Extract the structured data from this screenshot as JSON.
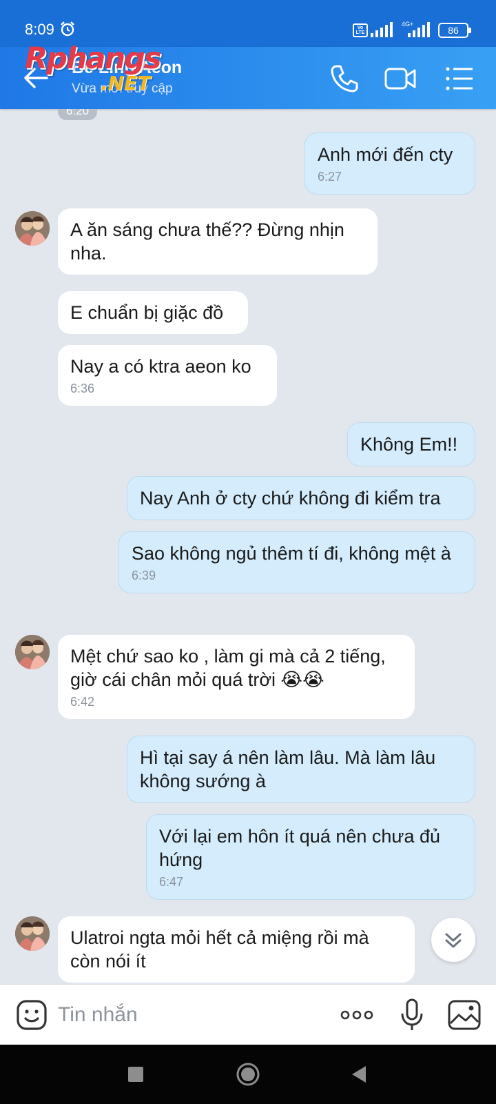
{
  "status_bar": {
    "time": "8:09",
    "volte": "Vo LTE",
    "network": "4G+",
    "battery": "86"
  },
  "header": {
    "contact_name": "Bé Linh Aeon",
    "contact_status": "Vừa mới truy cập",
    "watermark_main": "Rphangs",
    "watermark_suffix": ".NET",
    "icons": [
      "back-arrow-icon",
      "phone-icon",
      "video-call-icon",
      "menu-list-icon"
    ]
  },
  "chat": {
    "top_time_chip": "6:20",
    "messages": [
      {
        "side": "out",
        "text": "Anh mới đến cty",
        "time": "6:27"
      },
      {
        "side": "in",
        "text": "A ăn sáng chưa thế?? Đừng nhịn nha.",
        "time": ""
      },
      {
        "side": "in",
        "text": "E chuẩn bị giặc đồ",
        "time": ""
      },
      {
        "side": "in",
        "text": "Nay a có ktra aeon ko",
        "time": "6:36"
      },
      {
        "side": "out",
        "text": "Không Em!!",
        "time": ""
      },
      {
        "side": "out",
        "text": "Nay Anh ở cty chứ không đi kiểm tra",
        "time": ""
      },
      {
        "side": "out",
        "text": "Sao không ngủ thêm tí đi, không mệt à",
        "time": "6:39"
      },
      {
        "side": "in",
        "text": "Mệt chứ sao ko , làm gi mà cả 2 tiếng, giờ cái chân mỏi quá trời 😭😭",
        "time": "6:42"
      },
      {
        "side": "out",
        "text": "Hì tại say á nên làm lâu. Mà làm lâu không sướng à",
        "time": ""
      },
      {
        "side": "out",
        "text": "Với lại em hôn ít quá nên chưa đủ hứng",
        "time": "6:47"
      },
      {
        "side": "in",
        "text": "Ulatroi ngta mỏi hết cả miệng rồi mà còn nói ít",
        "time": ""
      }
    ]
  },
  "input_bar": {
    "placeholder": "Tin nhắn",
    "icons": [
      "sticker-icon",
      "more-dots-icon",
      "microphone-icon",
      "image-icon"
    ]
  },
  "colors": {
    "header_start": "#1f78e6",
    "header_end": "#38a0f4",
    "chat_background": "#e2e7ee",
    "outgoing_bubble": "#d4ecfc",
    "incoming_bubble": "#ffffff"
  }
}
